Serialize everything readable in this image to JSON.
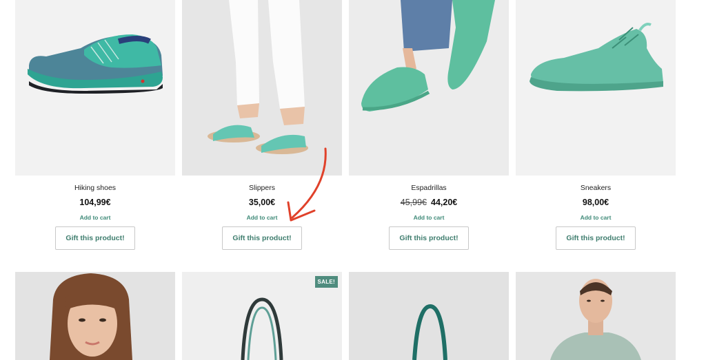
{
  "products": [
    {
      "name": "Hiking shoes",
      "price": "104,99€",
      "old_price": "",
      "add_label": "Add to cart",
      "gift_label": "Gift this product!",
      "icon": "hiking-shoe-image"
    },
    {
      "name": "Slippers",
      "price": "35,00€",
      "old_price": "",
      "add_label": "Add to cart",
      "gift_label": "Gift this product!",
      "icon": "slippers-image"
    },
    {
      "name": "Espadrillas",
      "price": "44,20€",
      "old_price": "45,99€",
      "add_label": "Add to cart",
      "gift_label": "Gift this product!",
      "icon": "espadrilles-image"
    },
    {
      "name": "Sneakers",
      "price": "98,00€",
      "old_price": "",
      "add_label": "Add to cart",
      "gift_label": "Gift this product!",
      "icon": "sneaker-image"
    }
  ],
  "row2": [
    {
      "icon": "woman-portrait-image",
      "badge": ""
    },
    {
      "icon": "tote-bag-image",
      "badge": "SALE!"
    },
    {
      "icon": "tote-bag-image",
      "badge": ""
    },
    {
      "icon": "man-portrait-image",
      "badge": ""
    }
  ],
  "colors": {
    "accent": "#3f8a78",
    "product_teal": "#5cc2a6",
    "annotation": "#e0412a"
  }
}
